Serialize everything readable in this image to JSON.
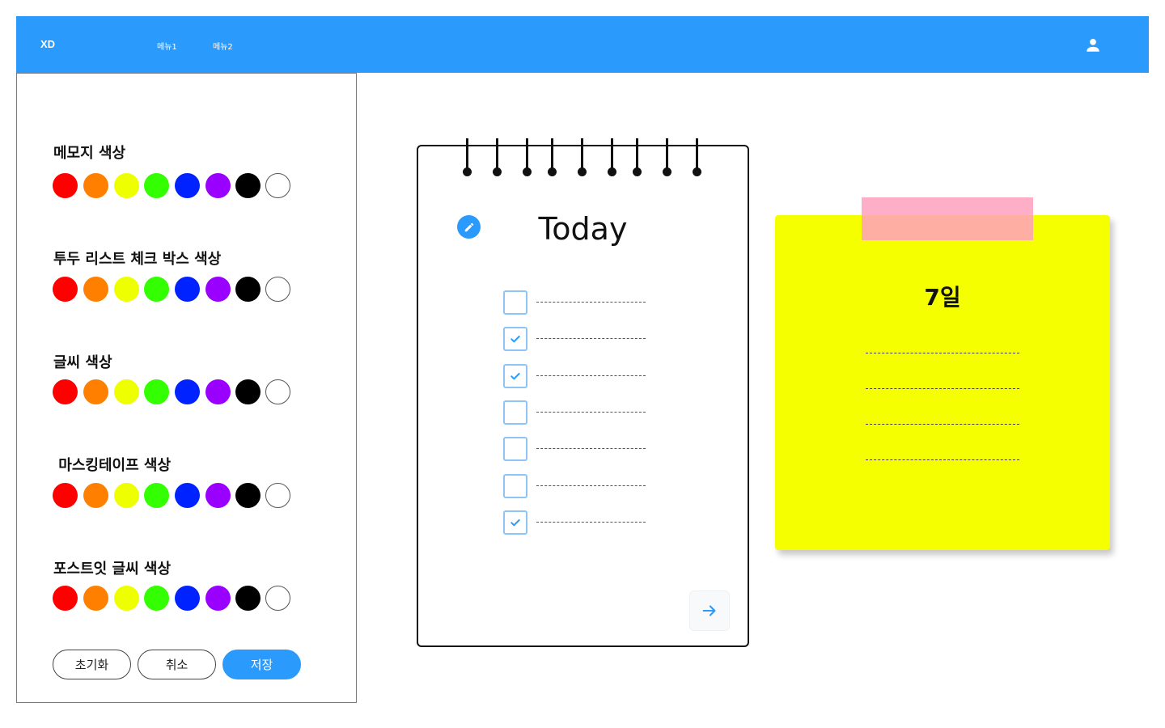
{
  "header": {
    "logo": "XD",
    "menu1": "메뉴1",
    "menu2": "메뉴2",
    "user_icon": "user-icon"
  },
  "settings": {
    "colors": [
      "#ff0000",
      "#ff8000",
      "#eeff00",
      "#33ff00",
      "#0022ff",
      "#9900ff",
      "#000000",
      "#ffffff"
    ],
    "sections": [
      {
        "title": "메모지 색상"
      },
      {
        "title": "투두 리스트 체크 박스 색상"
      },
      {
        "title": "글씨 색상"
      },
      {
        "title": " 마스킹테이프 색상"
      },
      {
        "title": "포스트잇 글씨 색상"
      }
    ],
    "buttons": {
      "reset": "초기화",
      "cancel": "취소",
      "save": "저장"
    }
  },
  "notebook": {
    "title": "Today",
    "edit_icon": "pencil-icon",
    "todos": [
      {
        "checked": false
      },
      {
        "checked": true
      },
      {
        "checked": true
      },
      {
        "checked": false
      },
      {
        "checked": false
      },
      {
        "checked": false
      },
      {
        "checked": true
      }
    ],
    "next_icon": "arrow-right-icon"
  },
  "sticky_note": {
    "title": "7일",
    "color": "#f5ff00",
    "tape_color": "#ffaabe"
  },
  "theme": {
    "accent": "#2a9afc"
  }
}
